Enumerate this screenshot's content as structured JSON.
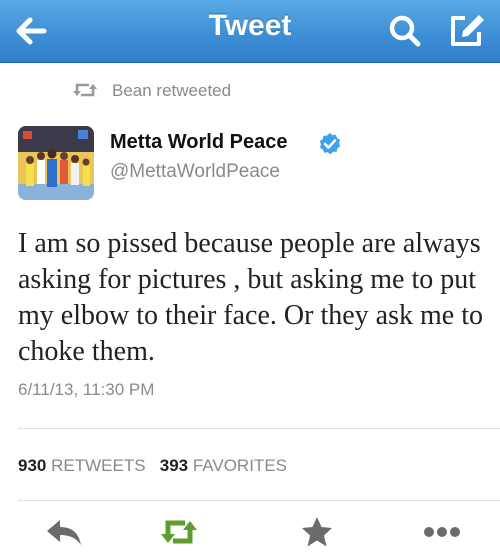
{
  "navbar": {
    "title": "Tweet",
    "accent": "#3f8fd6",
    "icons": {
      "back": "back-arrow-icon",
      "search": "search-icon",
      "compose": "compose-icon"
    }
  },
  "retweet_context": {
    "text": "Bean retweeted",
    "icon": "retweet-icon"
  },
  "author": {
    "name": "Metta World Peace",
    "handle": "@MettaWorldPeace",
    "verified_icon": "verified-badge-icon",
    "verified_color": "#3ea1ec"
  },
  "tweet": {
    "text": "I am so pissed because people are always asking for pictures , but asking me to put my elbow to their face. Or they ask me to choke them.",
    "timestamp": "6/11/13, 11:30 PM"
  },
  "stats": {
    "retweets_count": "930",
    "retweets_label": "RETWEETS",
    "favorites_count": "393",
    "favorites_label": "FAVORITES"
  },
  "actions": {
    "reply": "reply-icon",
    "retweet": "retweet-icon",
    "retweet_color": "#5c9e2e",
    "favorite": "star-icon",
    "more": "more-icon"
  }
}
